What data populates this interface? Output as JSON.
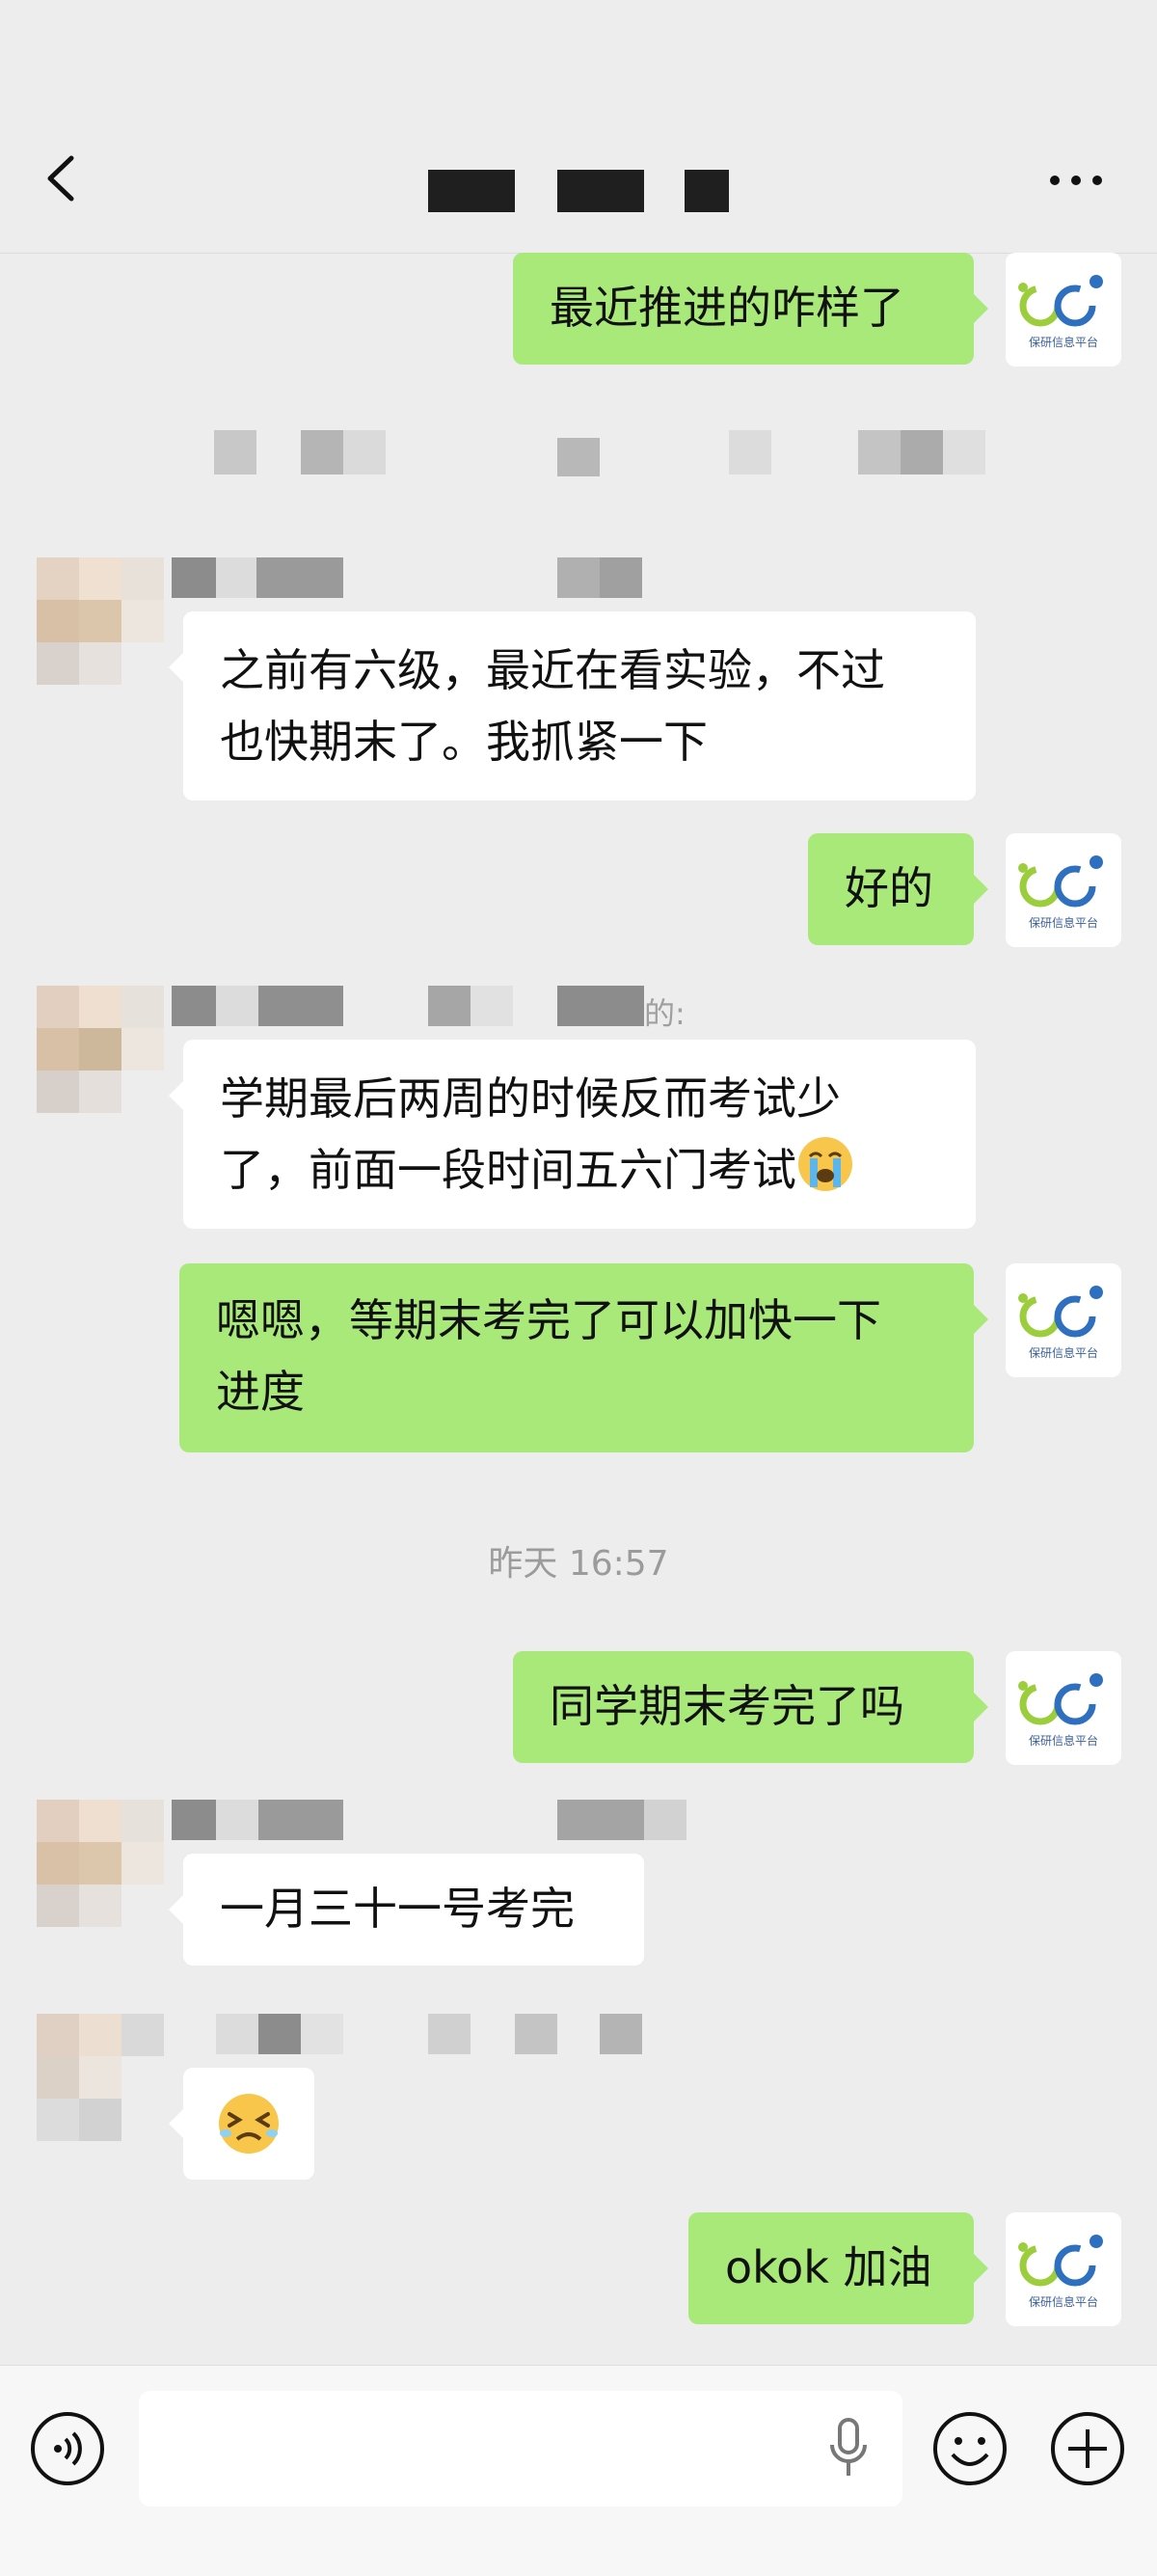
{
  "header": {
    "title_redacted": true,
    "back_icon": "chevron-left-icon",
    "more_icon": "more-horizontal-icon"
  },
  "self_avatar": {
    "text": "保研信息平台",
    "colors": {
      "green": "#9ccd3d",
      "blue": "#2f6fbf"
    }
  },
  "messages": [
    {
      "from": "self",
      "lines": [
        "最近推进的咋样了"
      ]
    },
    {
      "from": "other",
      "lines": [
        "之前有六级，最近在看实验，不过",
        "也快期末了。我抓紧一下"
      ]
    },
    {
      "from": "self",
      "lines": [
        "好的"
      ]
    },
    {
      "from": "other",
      "lines": [
        "学期最后两周的时候反而考试少",
        "了，前面一段时间五六门考试"
      ],
      "emoji": "loudly-crying-face"
    },
    {
      "from": "self",
      "lines": [
        "嗯嗯，等期末考完了可以加快一下",
        "进度"
      ]
    },
    {
      "from": "self",
      "lines": [
        "同学期末考完了吗"
      ]
    },
    {
      "from": "other",
      "lines": [
        "一月三十一号考完"
      ]
    },
    {
      "from": "other",
      "lines": [],
      "emoji": "persevering-face"
    },
    {
      "from": "self",
      "lines": [
        "okok 加油"
      ]
    }
  ],
  "timestamp": "昨天 16:57",
  "partial_text": "的:",
  "input": {
    "placeholder": "",
    "voice_icon": "voice-mode-icon",
    "mic_icon": "microphone-icon",
    "emoji_icon": "emoji-icon",
    "plus_icon": "plus-circle-icon"
  },
  "colors": {
    "background": "#ededed",
    "self_bubble": "#a9e97a",
    "other_bubble": "#ffffff",
    "timestamp": "#9b9b9b"
  }
}
